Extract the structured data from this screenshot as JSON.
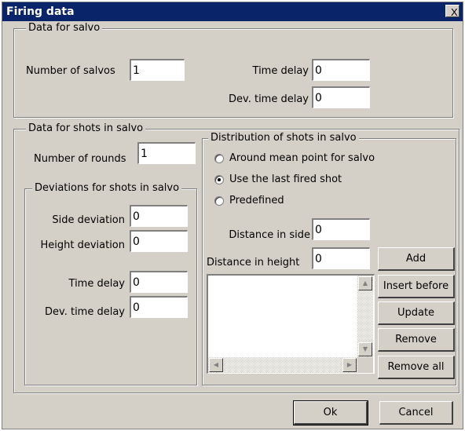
{
  "window": {
    "title": "Firing data",
    "close_label": "X"
  },
  "salvo": {
    "legend": "Data for salvo",
    "num_salvos_label": "Number of salvos",
    "num_salvos_value": "1",
    "time_delay_label": "Time delay",
    "time_delay_value": "0",
    "dev_time_delay_label": "Dev. time delay",
    "dev_time_delay_value": "0"
  },
  "shots": {
    "legend": "Data for shots in salvo",
    "num_rounds_label": "Number of rounds",
    "num_rounds_value": "1",
    "deviations": {
      "legend": "Deviations for shots in salvo",
      "side_label": "Side deviation",
      "side_value": "0",
      "height_label": "Height deviation",
      "height_value": "0",
      "time_delay_label": "Time delay",
      "time_delay_value": "0",
      "dev_time_delay_label": "Dev. time delay",
      "dev_time_delay_value": "0"
    },
    "distribution": {
      "legend": "Distribution of shots in salvo",
      "options": [
        "Around mean point for salvo",
        "Use the last fired shot",
        "Predefined"
      ],
      "selected": "Use the last fired shot",
      "dist_side_label": "Distance in side",
      "dist_side_value": "0",
      "dist_height_label": "Distance in height",
      "dist_height_value": "0",
      "buttons": {
        "add": "Add",
        "insert_before": "Insert before",
        "update": "Update",
        "remove": "Remove",
        "remove_all": "Remove all"
      }
    }
  },
  "footer": {
    "ok": "Ok",
    "cancel": "Cancel"
  }
}
